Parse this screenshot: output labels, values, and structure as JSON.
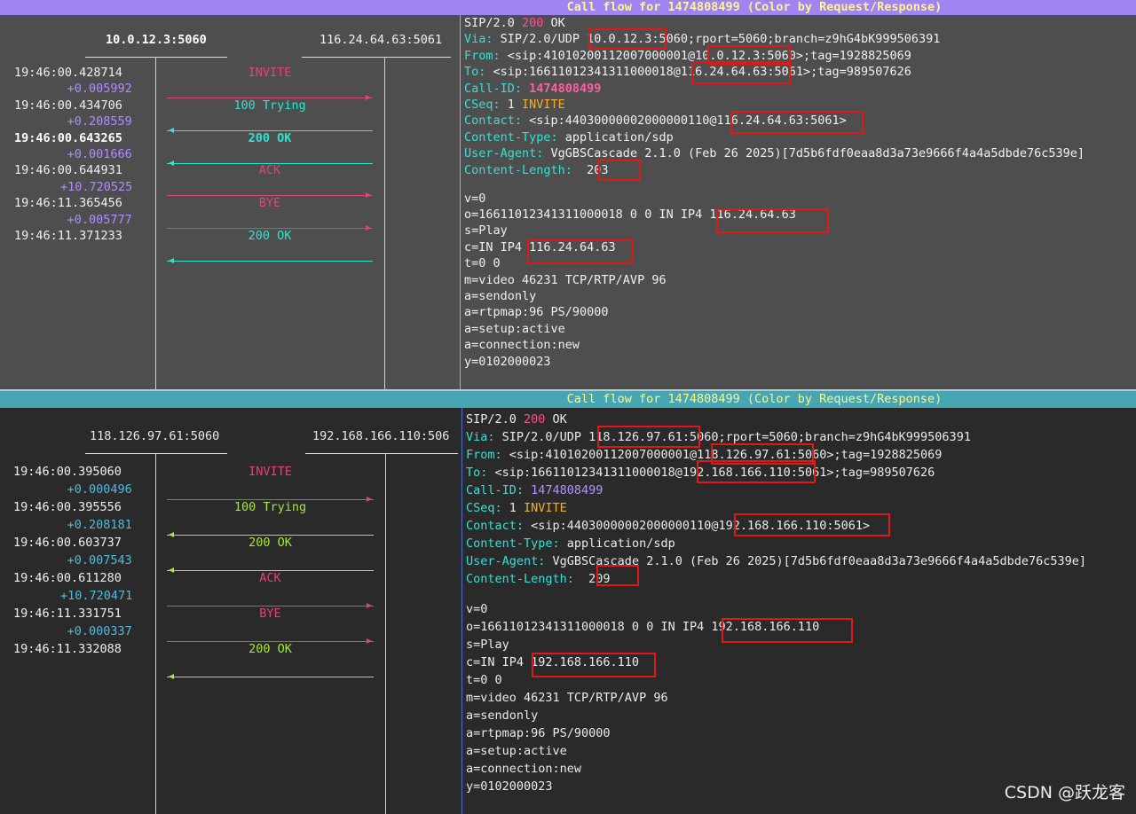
{
  "top": {
    "title": "Call flow for 1474808499 (Color by Request/Response)",
    "left_host": "10.0.12.3:5060",
    "right_host": "116.24.64.63:5061",
    "times": [
      {
        "t": "19:46:00.428714",
        "d": "+0.005992"
      },
      {
        "t": "19:46:00.434706",
        "d": "+0.208559"
      },
      {
        "t": "19:46:00.643265",
        "d": "+0.001666"
      },
      {
        "t": "19:46:00.644931",
        "d": "+10.720525"
      },
      {
        "t": "19:46:11.365456",
        "d": "+0.005777"
      },
      {
        "t": "19:46:11.371233",
        "d": ""
      }
    ],
    "msgs": [
      {
        "label": "INVITE",
        "dir": "right"
      },
      {
        "label": "100 Trying",
        "dir": "left"
      },
      {
        "label": "200 OK",
        "dir": "left"
      },
      {
        "label": "ACK",
        "dir": "right"
      },
      {
        "label": "BYE",
        "dir": "right"
      },
      {
        "label": "200 OK",
        "dir": "left"
      }
    ],
    "detail": [
      "SIP/2.0 200 OK",
      "Via: SIP/2.0/UDP 10.0.12.3:5060;rport=5060;branch=z9hG4bK999506391",
      "From: <sip:41010200112007000001@10.0.12.3:5060>;tag=1928825069",
      "To: <sip:16611012341311000018@116.24.64.63:5061>;tag=989507626",
      "Call-ID: 1474808499",
      "CSeq: 1 INVITE",
      "Contact: <sip:44030000002000000110@116.24.64.63:5061>",
      "Content-Type: application/sdp",
      "User-Agent: VgGBSCascade 2.1.0 (Feb 26 2025)[7d5b6fdf0eaa8d3a73e9666f4a4a5dbde76c539e]",
      "Content-Length:  203",
      "",
      "v=0",
      "o=16611012341311000018 0 0 IN IP4 116.24.64.63",
      "s=Play",
      "c=IN IP4 116.24.64.63",
      "t=0 0",
      "m=video 46231 TCP/RTP/AVP 96",
      "a=sendonly",
      "a=rtpmap:96 PS/90000",
      "a=setup:active",
      "a=connection:new",
      "y=0102000023"
    ]
  },
  "bottom": {
    "title": "Call flow for 1474808499 (Color by Request/Response)",
    "left_host": "118.126.97.61:5060",
    "right_host": "192.168.166.110:506",
    "times": [
      {
        "t": "19:46:00.395060",
        "d": "+0.000496"
      },
      {
        "t": "19:46:00.395556",
        "d": "+0.208181"
      },
      {
        "t": "19:46:00.603737",
        "d": "+0.007543"
      },
      {
        "t": "19:46:00.611280",
        "d": "+10.720471"
      },
      {
        "t": "19:46:11.331751",
        "d": "+0.000337"
      },
      {
        "t": "19:46:11.332088",
        "d": ""
      }
    ],
    "msgs": [
      {
        "label": "INVITE",
        "dir": "right"
      },
      {
        "label": "100 Trying",
        "dir": "left"
      },
      {
        "label": "200 OK",
        "dir": "left"
      },
      {
        "label": "ACK",
        "dir": "right"
      },
      {
        "label": "BYE",
        "dir": "right"
      },
      {
        "label": "200 OK",
        "dir": "left"
      }
    ],
    "detail": [
      "SIP/2.0 200 OK",
      "Via: SIP/2.0/UDP 118.126.97.61:5060;rport=5060;branch=z9hG4bK999506391",
      "From: <sip:41010200112007000001@118.126.97.61:5060>;tag=1928825069",
      "To: <sip:16611012341311000018@192.168.166.110:5061>;tag=989507626",
      "Call-ID: 1474808499",
      "CSeq: 1 INVITE",
      "Contact: <sip:44030000002000000110@192.168.166.110:5061>",
      "Content-Type: application/sdp",
      "User-Agent: VgGBSCascade 2.1.0 (Feb 26 2025)[7d5b6fdf0eaa8d3a73e9666f4a4a5dbde76c539e]",
      "Content-Length:  209",
      "",
      "v=0",
      "o=16611012341311000018 0 0 IN IP4 192.168.166.110",
      "s=Play",
      "c=IN IP4 192.168.166.110",
      "t=0 0",
      "m=video 46231 TCP/RTP/AVP 96",
      "a=sendonly",
      "a=rtpmap:96 PS/90000",
      "a=setup:active",
      "a=connection:new",
      "y=0102000023"
    ]
  },
  "colors": {
    "request_top": "#e0447a",
    "response_top": "#2ee3d0",
    "response_top_ok": "#2ee3d0",
    "request_bottom": "#e0447a",
    "response_bottom": "#a8e63a",
    "delta_top": "#b08cff",
    "delta_bottom": "#56b8d8",
    "key": "#34e0d5",
    "status": "#ff4d8b",
    "method": "#f0b02a"
  },
  "watermark": "CSDN @跃龙客"
}
